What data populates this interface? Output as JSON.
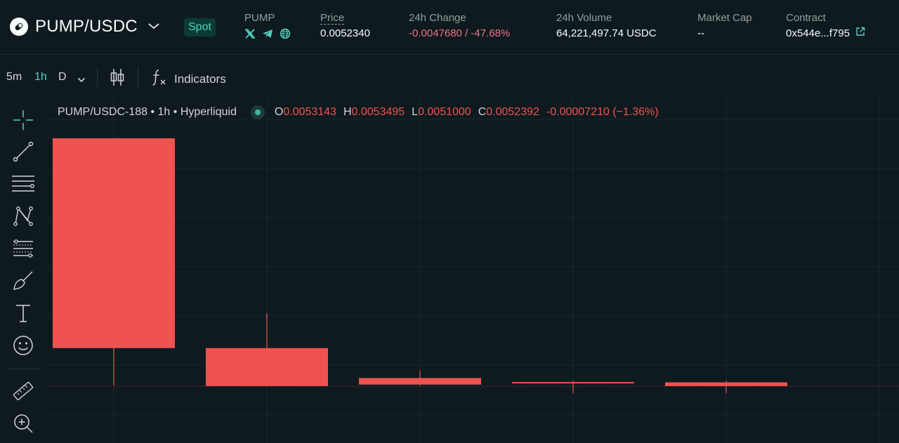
{
  "header": {
    "pair": "PUMP/USDC",
    "market_type": "Spot",
    "token": {
      "label": "PUMP",
      "socials": [
        "x-icon",
        "telegram-icon",
        "globe-icon"
      ]
    },
    "price": {
      "label": "Price",
      "value": "0.0052340"
    },
    "change_24h": {
      "label": "24h Change",
      "value": "-0.0047680 / -47.68%"
    },
    "volume_24h": {
      "label": "24h Volume",
      "value": "64,221,497.74 USDC"
    },
    "market_cap": {
      "label": "Market Cap",
      "value": "--"
    },
    "contract": {
      "label": "Contract",
      "value": "0x544e...f795"
    }
  },
  "toolbar": {
    "timeframes": [
      "5m",
      "1h",
      "D"
    ],
    "active_timeframe": "1h",
    "indicators_label": "Indicators"
  },
  "tools": [
    "crosshair-icon",
    "trend-line-icon",
    "horizontal-lines-icon",
    "pattern-icon",
    "fib-icon",
    "brush-icon",
    "text-icon",
    "emoji-icon",
    "ruler-icon",
    "zoom-in-icon"
  ],
  "legend": {
    "title": "PUMP/USDC-188 • 1h • Hyperliquid",
    "o_key": "O",
    "o": "0.0053143",
    "h_key": "H",
    "h": "0.0053495",
    "l_key": "L",
    "l": "0.0051000",
    "c_key": "C",
    "c": "0.0052392",
    "change": "-0.00007210 (−1.36%)"
  },
  "colors": {
    "background": "#0f1a1f",
    "accent": "#50d2c1",
    "down": "#ef5350",
    "negative_text": "#ed7088"
  },
  "chart_data": {
    "type": "candlestick",
    "interval": "1h",
    "candles": [
      {
        "open": 0.0102,
        "high": 0.0102,
        "low": 0.00525,
        "close": 0.006
      },
      {
        "open": 0.006,
        "high": 0.0067,
        "low": 0.00525,
        "close": 0.00524
      },
      {
        "open": 0.0054,
        "high": 0.00555,
        "low": 0.00525,
        "close": 0.00527
      },
      {
        "open": 0.00532,
        "high": 0.00535,
        "low": 0.0051,
        "close": 0.0053
      },
      {
        "open": 0.0053143,
        "high": 0.0053495,
        "low": 0.0051,
        "close": 0.0052392
      }
    ],
    "last_price": 0.005234,
    "grid": true
  }
}
